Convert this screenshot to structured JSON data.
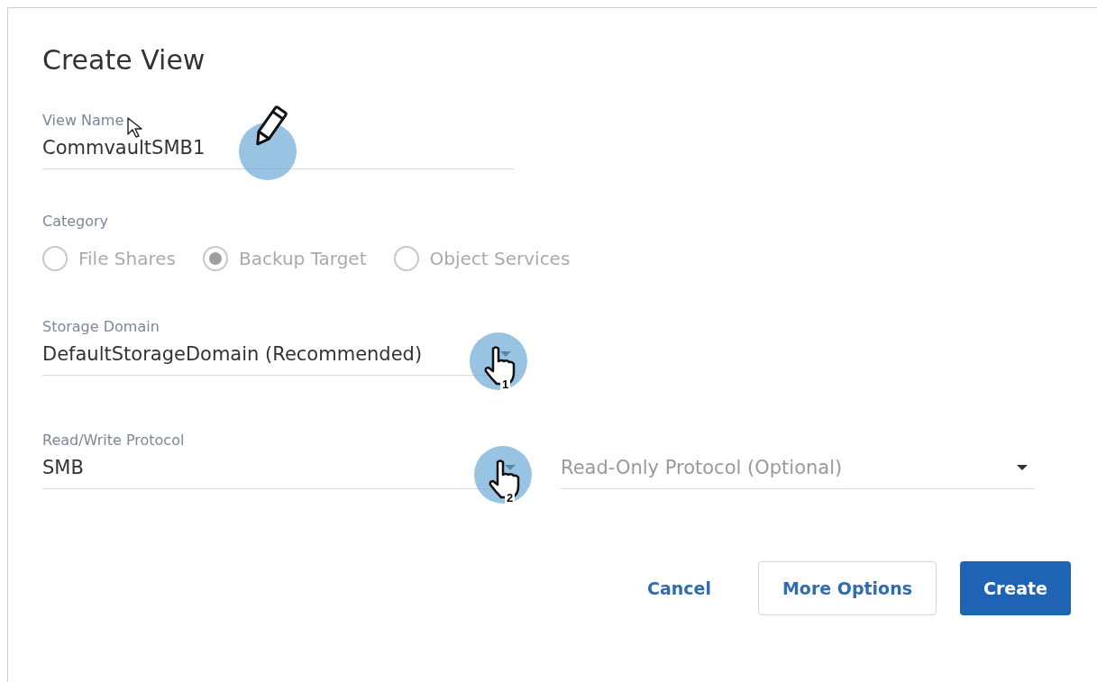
{
  "dialog": {
    "title": "Create View"
  },
  "view_name": {
    "label": "View Name",
    "value": "CommvaultSMB1",
    "cursor": true,
    "annotation": {
      "kind": "pencil"
    }
  },
  "category": {
    "label": "Category",
    "disabled": true,
    "options": [
      {
        "label": "File Shares",
        "selected": false
      },
      {
        "label": "Backup Target",
        "selected": true
      },
      {
        "label": "Object Services",
        "selected": false
      }
    ]
  },
  "storage_domain": {
    "label": "Storage Domain",
    "value": "DefaultStorageDomain (Recommended)",
    "annotation": {
      "kind": "hand",
      "number": "1"
    }
  },
  "protocols": {
    "label": "Read/Write Protocol",
    "read_write": {
      "value": "SMB",
      "annotation": {
        "kind": "hand",
        "number": "2"
      }
    },
    "read_only": {
      "placeholder": "Read-Only Protocol (Optional)"
    }
  },
  "buttons": [
    {
      "label": "Cancel",
      "kind": "text"
    },
    {
      "label": "More Options",
      "kind": "outlined"
    },
    {
      "label": "Create",
      "kind": "primary"
    }
  ]
}
